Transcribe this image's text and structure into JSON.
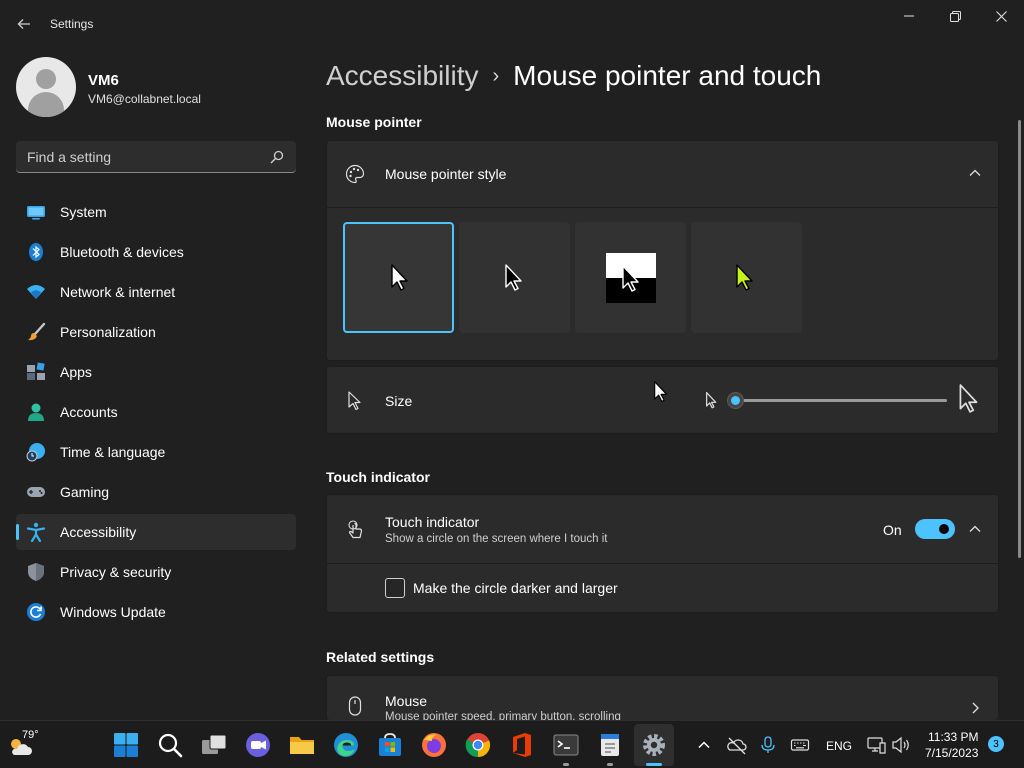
{
  "window": {
    "title": "Settings",
    "back_icon": "arrow-left-icon",
    "controls": [
      "minimize-icon",
      "restore-icon",
      "close-icon"
    ]
  },
  "profile": {
    "name": "VM6",
    "email": "VM6@collabnet.local"
  },
  "search": {
    "placeholder": "Find a setting"
  },
  "sidebar": {
    "items": [
      {
        "label": "System",
        "icon": "monitor-icon"
      },
      {
        "label": "Bluetooth & devices",
        "icon": "bluetooth-icon"
      },
      {
        "label": "Network & internet",
        "icon": "wifi-icon"
      },
      {
        "label": "Personalization",
        "icon": "paintbrush-icon"
      },
      {
        "label": "Apps",
        "icon": "apps-icon"
      },
      {
        "label": "Accounts",
        "icon": "person-icon"
      },
      {
        "label": "Time & language",
        "icon": "globe-clock-icon"
      },
      {
        "label": "Gaming",
        "icon": "gamepad-icon"
      },
      {
        "label": "Accessibility",
        "icon": "accessibility-icon",
        "active": true
      },
      {
        "label": "Privacy & security",
        "icon": "shield-icon"
      },
      {
        "label": "Windows Update",
        "icon": "refresh-icon"
      }
    ]
  },
  "breadcrumb": {
    "parent": "Accessibility",
    "separator": "›",
    "current": "Mouse pointer and touch"
  },
  "mouse_pointer": {
    "section_title": "Mouse pointer",
    "style_label": "Mouse pointer style",
    "style_options": [
      "white-pointer",
      "black-pointer",
      "inverted-pointer",
      "custom-color-pointer"
    ],
    "selected_style": 0,
    "custom_color": "#c6f219",
    "size_label": "Size",
    "size_value": 0
  },
  "touch": {
    "section_title": "Touch indicator",
    "label": "Touch indicator",
    "description": "Show a circle on the screen where I touch it",
    "state_text": "On",
    "enabled": true,
    "checkbox_label": "Make the circle darker and larger",
    "checkbox_checked": false
  },
  "related": {
    "section_title": "Related settings",
    "mouse_label": "Mouse",
    "mouse_description": "Mouse pointer speed, primary button, scrolling"
  },
  "taskbar": {
    "weather_temp": "79°",
    "apps": [
      "start-icon",
      "search-icon",
      "task-view-icon",
      "teams-chat-icon",
      "file-explorer-icon",
      "edge-icon",
      "store-icon",
      "firefox-icon",
      "chrome-icon",
      "office-icon",
      "terminal-icon",
      "notepad-icon",
      "settings-icon"
    ],
    "language": "ENG",
    "time": "11:33 PM",
    "date": "7/15/2023",
    "notification_count": "3"
  },
  "colors": {
    "accent": "#4cc2ff",
    "background": "#202020",
    "card": "#2b2b2b"
  }
}
